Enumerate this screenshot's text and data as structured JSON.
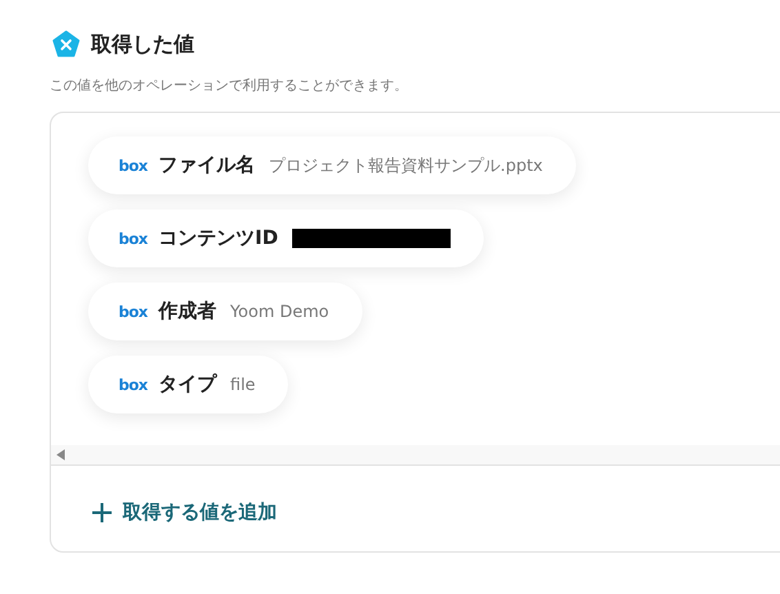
{
  "header": {
    "title": "取得した値",
    "description": "この値を他のオペレーションで利用することができます。"
  },
  "values": [
    {
      "kind": "text",
      "source": "box",
      "label": "ファイル名",
      "value": "プロジェクト報告資料サンプル.pptx"
    },
    {
      "kind": "redacted",
      "source": "box",
      "label": "コンテンツID"
    },
    {
      "kind": "text",
      "source": "box",
      "label": "作成者",
      "value": "Yoom Demo"
    },
    {
      "kind": "text",
      "source": "box",
      "label": "タイプ",
      "value": "file"
    }
  ],
  "add_button": {
    "label": "取得する値を追加"
  }
}
